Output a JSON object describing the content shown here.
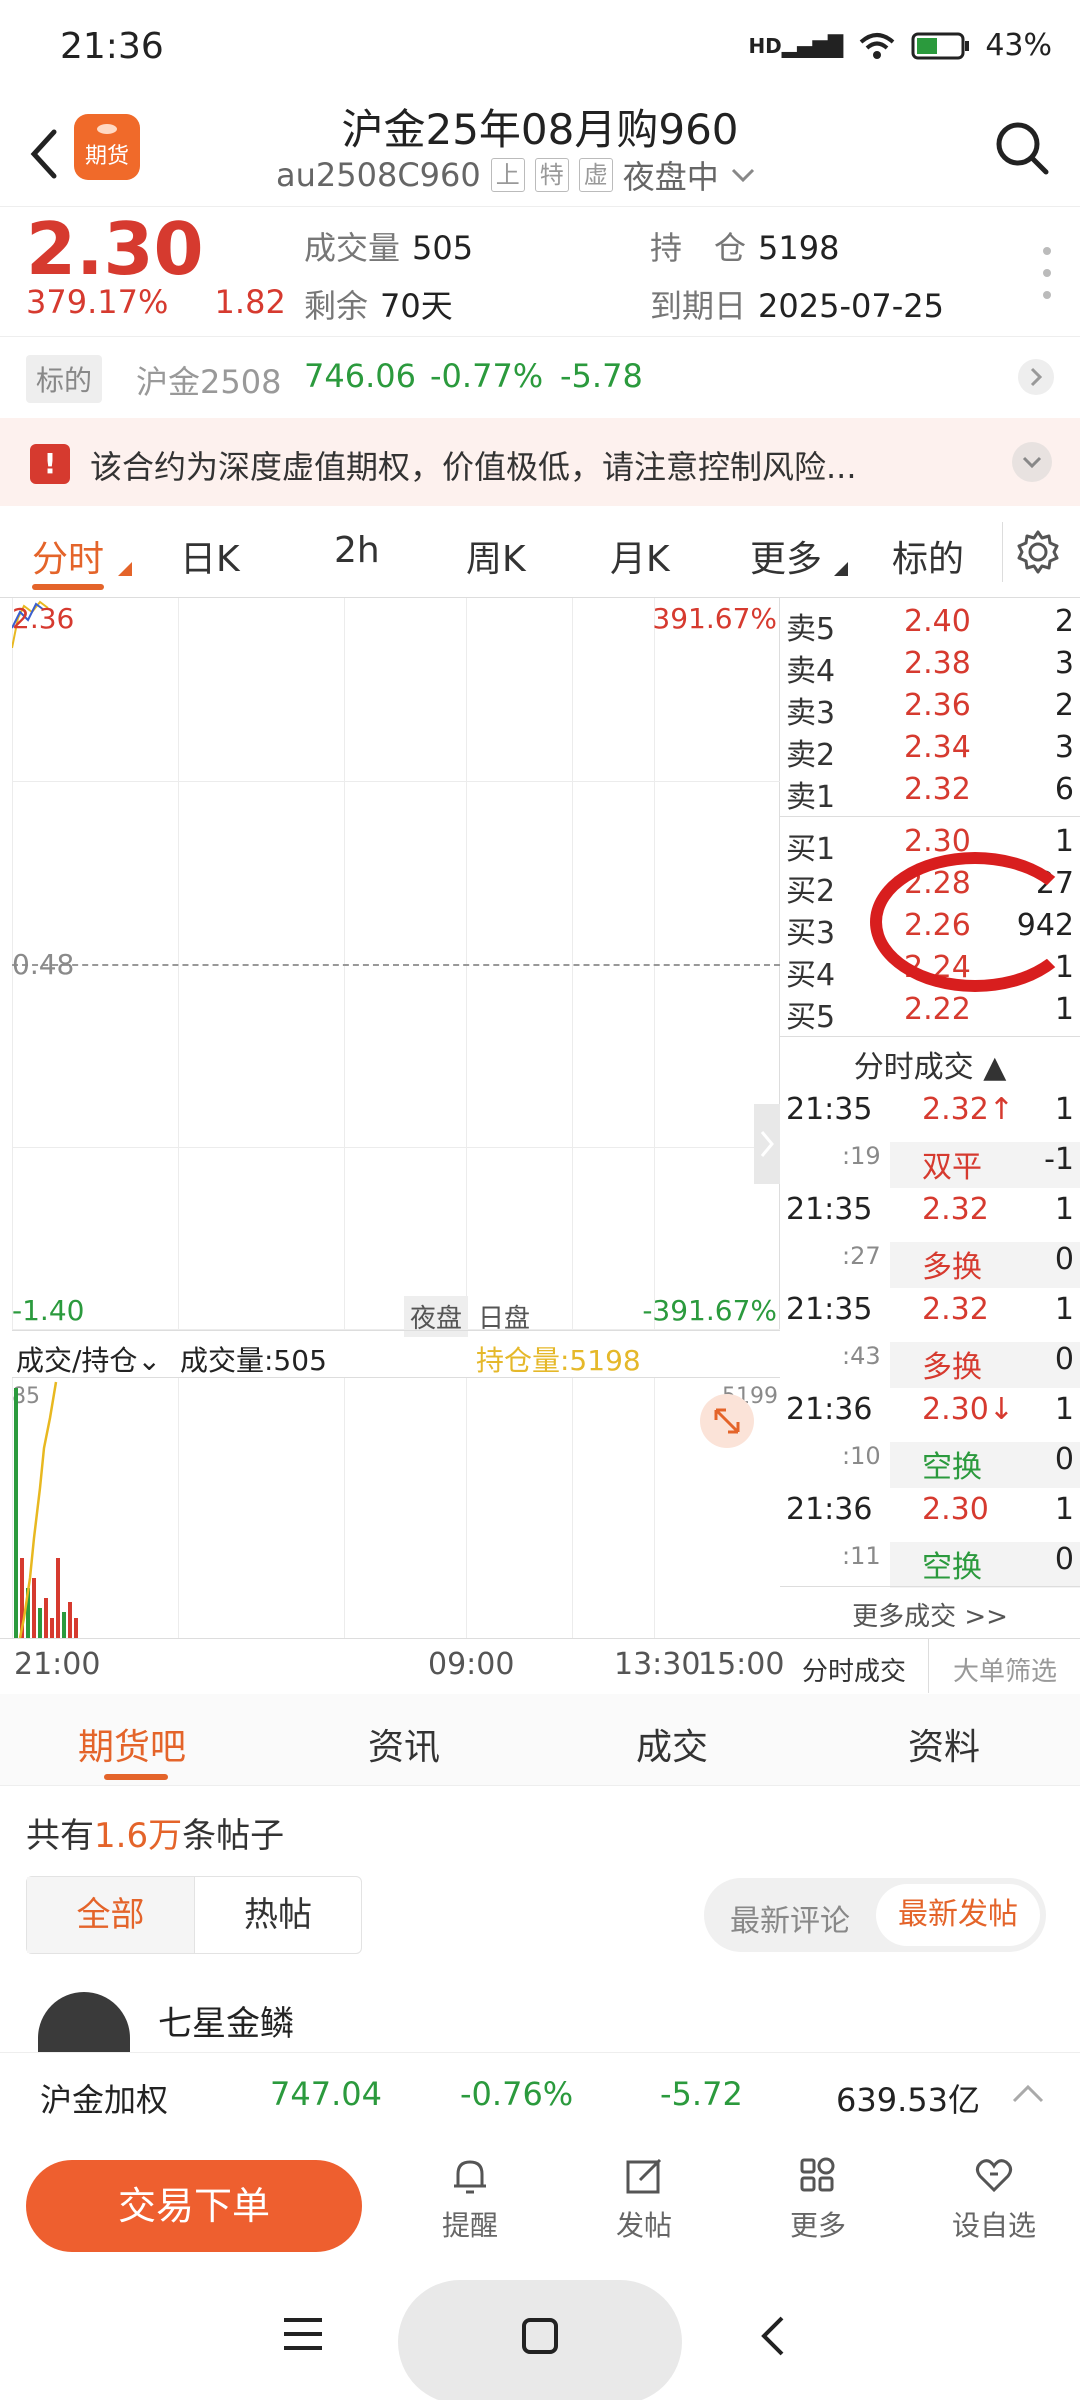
{
  "status": {
    "time": "21:36",
    "battery": "43%",
    "network": "HD"
  },
  "header": {
    "title": "沪金25年08月购960",
    "code": "au2508C960",
    "tags": [
      "上",
      "特",
      "虚"
    ],
    "session": "夜盘中",
    "logo_text": "期货"
  },
  "quote": {
    "price": "2.30",
    "change_pct": "379.17%",
    "change": "1.82",
    "volume_label": "成交量",
    "volume": "505",
    "oi_label": "持　仓",
    "oi": "5198",
    "days_label": "剩余",
    "days": "70天",
    "expiry_label": "到期日",
    "expiry": "2025-07-25"
  },
  "underlying": {
    "label": "标的",
    "name": "沪金2508",
    "price": "746.06",
    "pct": "-0.77%",
    "change": "-5.78"
  },
  "warning": {
    "text": "该合约为深度虚值期权，价值极低，请注意控制风险..."
  },
  "tabs": [
    "分时",
    "日K",
    "2h",
    "周K",
    "月K",
    "更多",
    "标的"
  ],
  "chart": {
    "top_left": "2.36",
    "top_right": "391.67%",
    "mid_left": "0.48",
    "bottom_left": "-1.40",
    "bottom_right": "-391.67%",
    "night_label": "夜盘",
    "day_label": "日盘",
    "vol_selector": "成交/持仓",
    "vol_text": "成交量:505",
    "oi_text": "持仓量:5198",
    "vol_max": "85",
    "oi_max": "5199",
    "time_ticks": [
      "21:00",
      "09:00",
      "13:30",
      "15:00"
    ]
  },
  "orderbook": {
    "asks": [
      {
        "name": "卖5",
        "price": "2.40",
        "qty": "2"
      },
      {
        "name": "卖4",
        "price": "2.38",
        "qty": "3"
      },
      {
        "name": "卖3",
        "price": "2.36",
        "qty": "2"
      },
      {
        "name": "卖2",
        "price": "2.34",
        "qty": "3"
      },
      {
        "name": "卖1",
        "price": "2.32",
        "qty": "6"
      }
    ],
    "bids": [
      {
        "name": "买1",
        "price": "2.30",
        "qty": "1"
      },
      {
        "name": "买2",
        "price": "2.28",
        "qty": "27"
      },
      {
        "name": "买3",
        "price": "2.26",
        "qty": "942"
      },
      {
        "name": "买4",
        "price": "2.24",
        "qty": "1"
      },
      {
        "name": "买5",
        "price": "2.22",
        "qty": "1"
      }
    ],
    "ticks_title": "分时成交",
    "ticks": [
      {
        "time": "21:35",
        "sec": ":19",
        "price": "2.32↑",
        "qty": "1",
        "type": "双平",
        "oi": "-1",
        "type_color": "red"
      },
      {
        "time": "21:35",
        "sec": ":27",
        "price": "2.32",
        "qty": "1",
        "type": "多换",
        "oi": "0",
        "type_color": "red"
      },
      {
        "time": "21:35",
        "sec": ":43",
        "price": "2.32",
        "qty": "1",
        "type": "多换",
        "oi": "0",
        "type_color": "red"
      },
      {
        "time": "21:36",
        "sec": ":10",
        "price": "2.30↓",
        "qty": "1",
        "type": "空换",
        "oi": "0",
        "type_color": "green"
      },
      {
        "time": "21:36",
        "sec": ":11",
        "price": "2.30",
        "qty": "1",
        "type": "空换",
        "oi": "0",
        "type_color": "green"
      }
    ],
    "more_trades": "更多成交 >>",
    "bottom_tabs": [
      "分时成交",
      "大单筛选"
    ]
  },
  "community": {
    "tabs": [
      "期货吧",
      "资讯",
      "成交",
      "资料"
    ],
    "count_prefix": "共有",
    "count": "1.6万",
    "count_suffix": "条帖子",
    "filters": [
      "全部",
      "热帖"
    ],
    "sorts": [
      "最新评论",
      "最新发帖"
    ],
    "first_user": "七星金鳞"
  },
  "index": {
    "name": "沪金加权",
    "price": "747.04",
    "pct": "-0.76%",
    "change": "-5.72",
    "amount": "639.53亿"
  },
  "actions": {
    "trade": "交易下单",
    "items": [
      "提醒",
      "发帖",
      "更多",
      "设自选"
    ]
  },
  "colors": {
    "accent": "#e4642a",
    "up": "#d63a2f",
    "down": "#2b9a3d"
  }
}
